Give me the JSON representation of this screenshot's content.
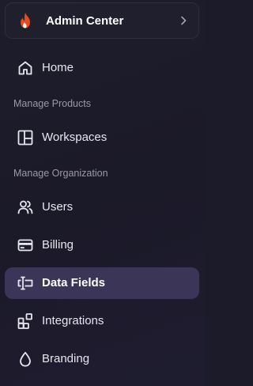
{
  "switcher": {
    "title": "Admin Center",
    "logo_icon": "flame-icon",
    "chevron_icon": "chevron-right-icon",
    "accent": "#e8491d"
  },
  "nav": {
    "home": {
      "label": "Home",
      "icon": "home-icon"
    },
    "section_products": "Manage Products",
    "workspaces": {
      "label": "Workspaces",
      "icon": "layout-icon"
    },
    "section_org": "Manage Organization",
    "users": {
      "label": "Users",
      "icon": "users-icon"
    },
    "billing": {
      "label": "Billing",
      "icon": "credit-card-icon"
    },
    "data_fields": {
      "label": "Data Fields",
      "icon": "data-fields-icon",
      "active": true
    },
    "integrations": {
      "label": "Integrations",
      "icon": "integrations-icon"
    },
    "branding": {
      "label": "Branding",
      "icon": "droplet-icon"
    }
  },
  "colors": {
    "background": "#1c1b29",
    "active_bg": "#3b3658",
    "text": "#e7e6ef",
    "section_text": "#9a99aa"
  }
}
